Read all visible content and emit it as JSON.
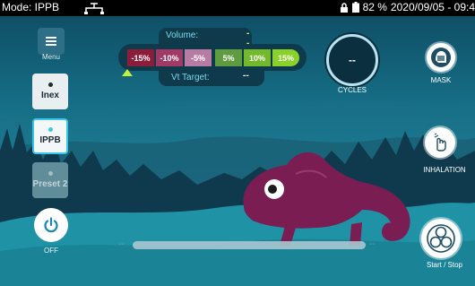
{
  "status_bar": {
    "mode": "Mode: IPPB",
    "battery": "82 %",
    "datetime": "2020/09/05 - 09:4"
  },
  "sidebar": {
    "menu_label": "Menu",
    "presets": [
      {
        "label": "Inex",
        "state": "available"
      },
      {
        "label": "IPPB",
        "state": "selected"
      },
      {
        "label": "Preset 2",
        "state": "disabled"
      }
    ],
    "power_label": "OFF"
  },
  "volume_panel": {
    "volume_label": "Volume:",
    "volume_value": "--",
    "segments": [
      {
        "label": "-15%",
        "color": "#8c1d3a"
      },
      {
        "label": "-10%",
        "color": "#a13b66"
      },
      {
        "label": "-5%",
        "color": "#b87ba3"
      },
      {
        "label": "5%",
        "color": "#5e9c3f"
      },
      {
        "label": "10%",
        "color": "#74b82c"
      },
      {
        "label": "15%",
        "color": "#8ad12c"
      }
    ],
    "vt_label": "Vt Target:",
    "vt_value": "--",
    "marker_color": "#c5ee3d"
  },
  "cycles": {
    "value": "--",
    "label": "CYCLES"
  },
  "right_controls": {
    "mask_label": "MASK",
    "inhalation_label": "INHALATION",
    "start_stop_label": "Start / Stop"
  },
  "progress": {
    "left_text": "--",
    "right_text": "--"
  },
  "icons": {
    "menu": "hamburger-icon",
    "power": "power-icon",
    "mask": "mask-icon",
    "inhalation": "hand-press-icon",
    "start_stop": "fan-icon",
    "lock": "lock-icon",
    "battery": "battery-icon",
    "usb": "usb-icon"
  },
  "colors": {
    "accent": "#38c7e8",
    "mascot": "#7a1d52",
    "panel": "#0e3a4c"
  }
}
